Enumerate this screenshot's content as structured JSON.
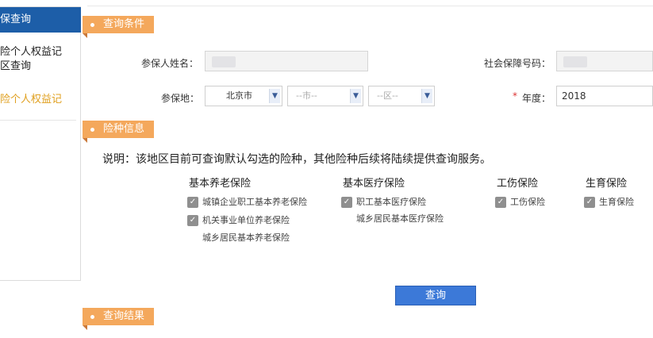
{
  "sidebar": {
    "header": "保查询",
    "items": [
      {
        "line1": "险个人权益记",
        "line2": "区查询"
      },
      {
        "line1": "险个人权益记"
      }
    ]
  },
  "sections": {
    "query_conditions": "查询条件",
    "insurance_info": "险种信息",
    "query_results": "查询结果"
  },
  "form": {
    "name_label": "参保人姓名：",
    "ssn_label": "社会保障号码：",
    "region_label": "参保地：",
    "province_value": "北京市",
    "city_value": "--市--",
    "district_value": "--区--",
    "required_mark": "*",
    "year_label": "年度：",
    "year_value": "2018"
  },
  "note": "说明：该地区目前可查询默认勾选的险种，其他险种后续将陆续提供查询服务。",
  "groups": {
    "pension": {
      "title": "基本养老保险",
      "items": [
        "城镇企业职工基本养老保险",
        "机关事业单位养老保险",
        "城乡居民基本养老保险"
      ]
    },
    "medical": {
      "title": "基本医疗保险",
      "items": [
        "职工基本医疗保险",
        "城乡居民基本医疗保险"
      ]
    },
    "injury": {
      "title": "工伤保险",
      "items": [
        "工伤保险"
      ]
    },
    "maternity": {
      "title": "生育保险",
      "items": [
        "生育保险"
      ]
    }
  },
  "query_button": "查询",
  "colors": {
    "sidebar_header": "#1d5ea8",
    "section_tag": "#f4a85c",
    "active_item": "#e0a020",
    "button": "#3c79d8"
  }
}
